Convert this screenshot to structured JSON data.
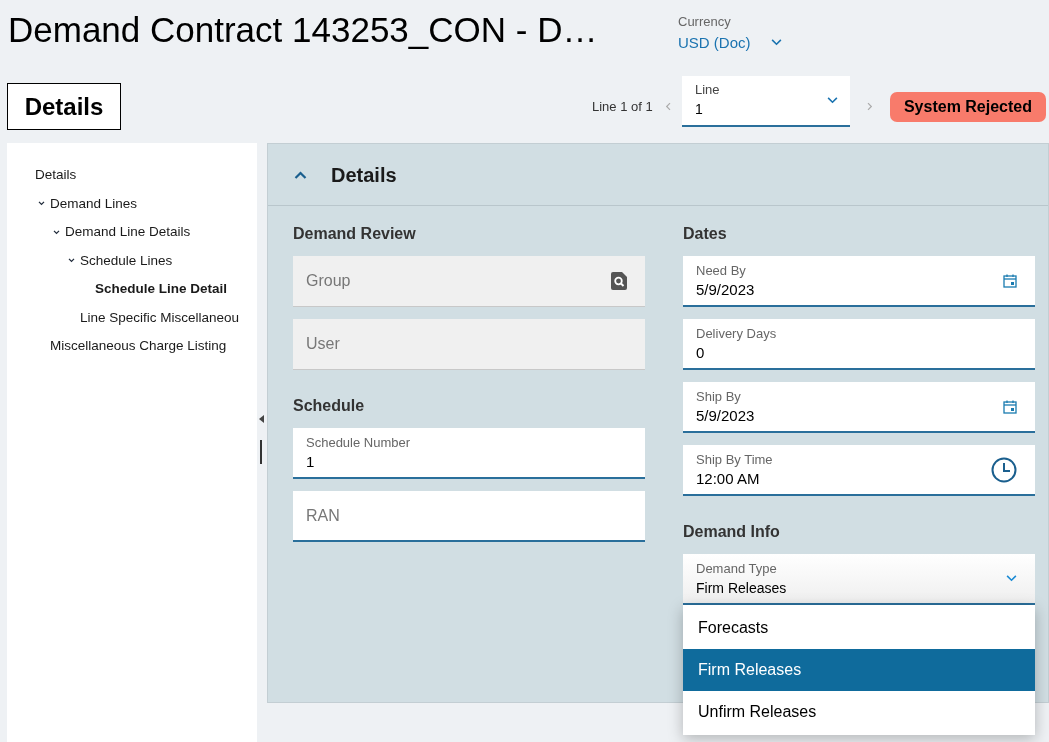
{
  "title": "Demand Contract 143253_CON - D…",
  "currency": {
    "label": "Currency",
    "value": "USD (Doc)"
  },
  "view_button": "Details",
  "line_nav": {
    "text": "Line 1 of 1",
    "field": {
      "label": "Line",
      "value": "1"
    }
  },
  "status_badge": "System Rejected",
  "sidebar": {
    "items": [
      {
        "label": "Details",
        "selected": false,
        "children": [
          {
            "label": "Demand Lines",
            "expanded": true,
            "selected": false,
            "children": [
              {
                "label": "Demand Line Details",
                "expanded": true,
                "selected": false,
                "children": [
                  {
                    "label": "Schedule Lines",
                    "expanded": true,
                    "selected": false,
                    "children": [
                      {
                        "label": "Schedule Line Detail",
                        "selected": true
                      }
                    ]
                  },
                  {
                    "label": "Line Specific Miscellaneou",
                    "selected": false
                  }
                ]
              }
            ]
          },
          {
            "label": "Miscellaneous Charge Listing",
            "selected": false
          }
        ]
      }
    ]
  },
  "panel": {
    "title": "Details",
    "expanded": true,
    "columns": [
      {
        "sections": [
          {
            "title": "Demand Review",
            "fields": [
              {
                "kind": "lookup",
                "placeholder": "Group",
                "disabled": true
              },
              {
                "kind": "text",
                "placeholder": "User",
                "disabled": true
              }
            ]
          },
          {
            "title": "Schedule",
            "fields": [
              {
                "kind": "text",
                "label": "Schedule Number",
                "value": "1",
                "disabled": false
              },
              {
                "kind": "text",
                "placeholder": "RAN",
                "disabled": false
              }
            ]
          }
        ]
      },
      {
        "sections": [
          {
            "title": "Dates",
            "fields": [
              {
                "kind": "date",
                "label": "Need By",
                "value": "5/9/2023",
                "disabled": false
              },
              {
                "kind": "text",
                "label": "Delivery Days",
                "value": "0",
                "disabled": false
              },
              {
                "kind": "date",
                "label": "Ship By",
                "value": "5/9/2023",
                "disabled": false
              },
              {
                "kind": "time",
                "label": "Ship By Time",
                "value": "12:00 AM",
                "disabled": false
              }
            ]
          },
          {
            "title": "Demand Info",
            "fields": [
              {
                "kind": "select",
                "label": "Demand Type",
                "value": "Firm Releases",
                "disabled": false,
                "expanded": true,
                "options": [
                  {
                    "label": "Forecasts",
                    "selected": false
                  },
                  {
                    "label": "Firm Releases",
                    "selected": true
                  },
                  {
                    "label": "Unfirm Releases",
                    "selected": false
                  }
                ]
              }
            ]
          }
        ]
      }
    ]
  }
}
